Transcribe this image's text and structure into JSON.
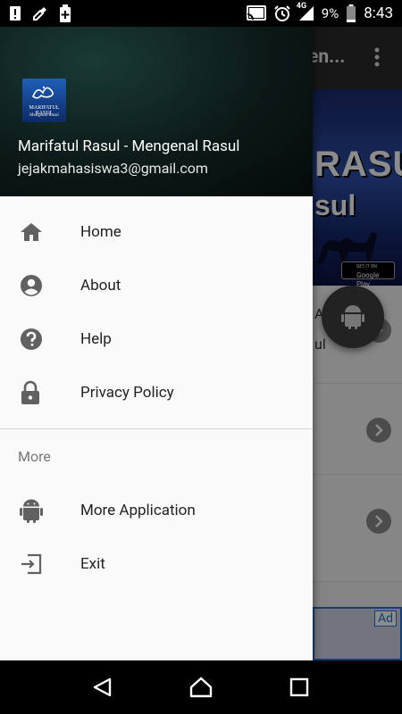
{
  "status_bar": {
    "battery": "9%",
    "network": "4G",
    "time": "8:43"
  },
  "background_app": {
    "toolbar_title": "en...",
    "banner_line1": "RASUL",
    "banner_line2": "sul",
    "play_badge_small": "GET IT ON",
    "play_badge": "Google Play",
    "item_title": "AS",
    "item_sub": "ul",
    "ad_label": "Ad"
  },
  "drawer": {
    "logo_line1": "MARIFATUL RASUL",
    "logo_line2": "Mengenal Rasul",
    "header_name": "Marifatul Rasul - Mengenal Rasul",
    "header_email": "jejakmahasiswa3@gmail.com",
    "items": [
      {
        "label": "Home",
        "icon": "home-icon"
      },
      {
        "label": "About",
        "icon": "account-circle-icon"
      },
      {
        "label": "Help",
        "icon": "help-icon"
      },
      {
        "label": "Privacy Policy",
        "icon": "lock-icon"
      }
    ],
    "section_title": "More",
    "more_items": [
      {
        "label": "More Application",
        "icon": "android-icon"
      },
      {
        "label": "Exit",
        "icon": "exit-icon"
      }
    ]
  },
  "colors": {
    "drawer_bg": "#fafafa",
    "icon_gray": "#616161",
    "header_bg": "#0b1716"
  }
}
